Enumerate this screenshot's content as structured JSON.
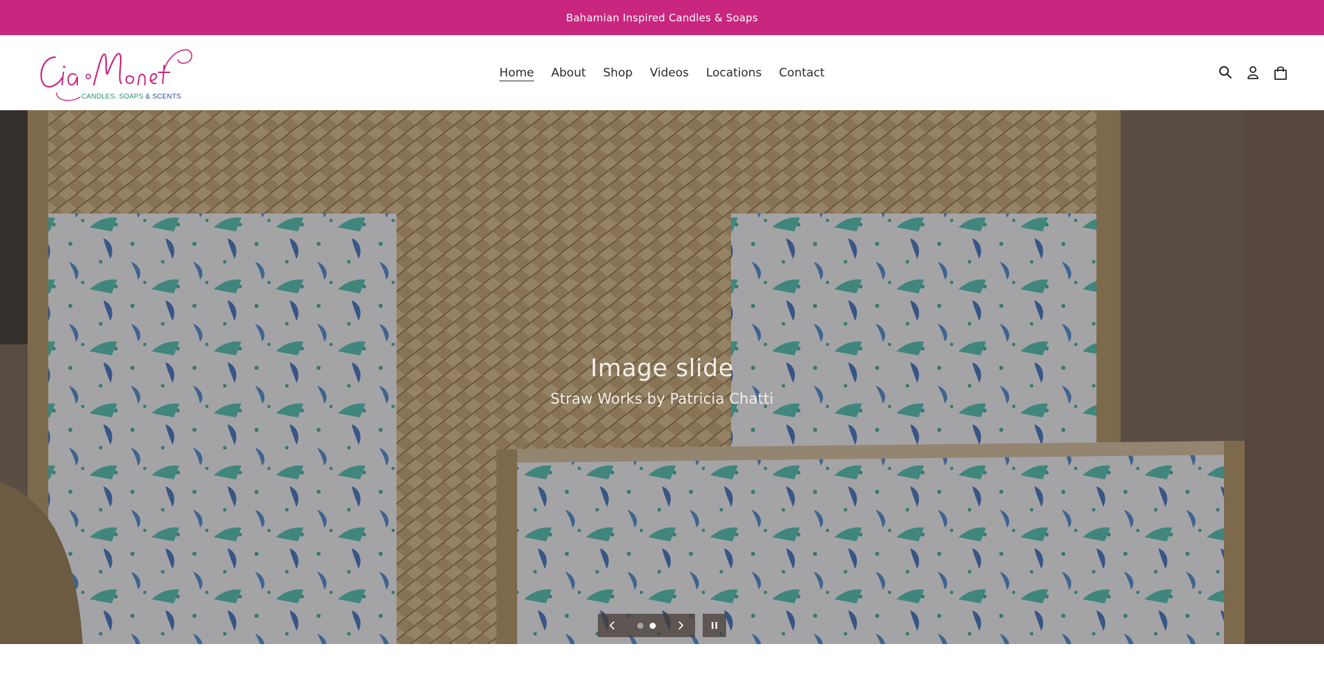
{
  "announcement": {
    "text": "Bahamian Inspired Candles & Soaps"
  },
  "brand": {
    "logo_script": "Cia Monet",
    "tagline_part1": "CANDLES, SOAPS",
    "tagline_part2": " & SCENTS",
    "colors": {
      "pink": "#c9267f",
      "green": "#2c8a73",
      "blue": "#2a4a92"
    }
  },
  "nav": {
    "items": [
      {
        "label": "Home",
        "active": true
      },
      {
        "label": "About"
      },
      {
        "label": "Shop"
      },
      {
        "label": "Videos"
      },
      {
        "label": "Locations"
      },
      {
        "label": "Contact"
      }
    ]
  },
  "header_icons": [
    "search-icon",
    "account-icon",
    "cart-icon"
  ],
  "hero": {
    "title": "Image slide",
    "subtitle": "Straw Works by Patricia Chatti",
    "slide_count": 2,
    "active_slide": 2
  }
}
